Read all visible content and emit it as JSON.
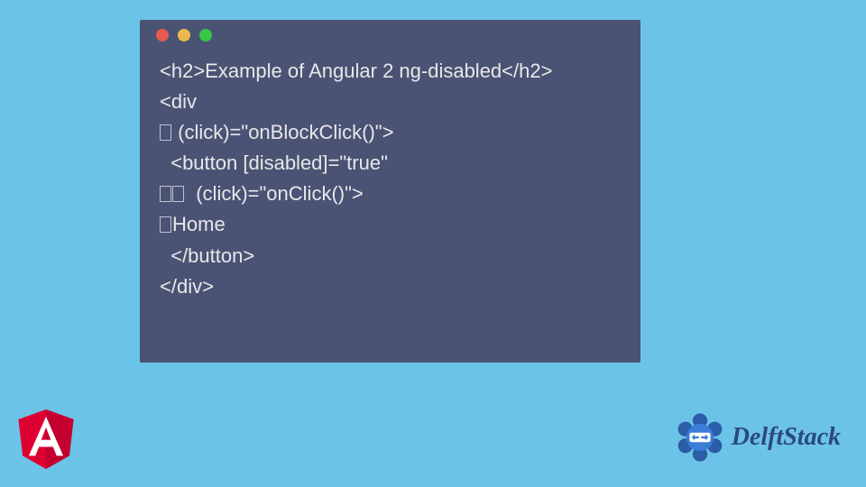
{
  "code": {
    "line1_open": "<h2>",
    "line1_text": "Example of Angular 2 ng-disabled",
    "line1_close": "</h2>",
    "line2": "<div",
    "line3": " (click)=\"onBlockClick()\">",
    "line4": "  <button [disabled]=\"true\"",
    "line5": "  (click)=\"onClick()\">",
    "line6": "Home",
    "line7": "  </button>",
    "line8": "</div>"
  },
  "brand": {
    "name": "DelftStack"
  }
}
